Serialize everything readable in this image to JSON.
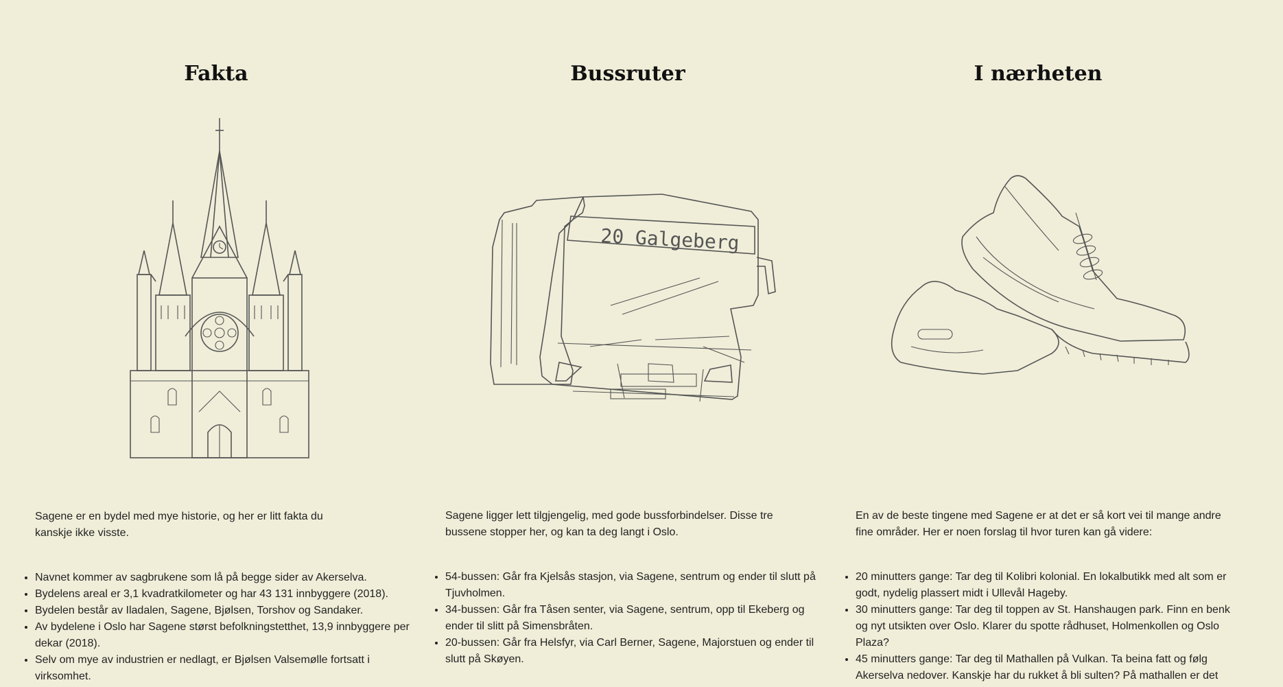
{
  "columns": [
    {
      "title": "Fakta",
      "icon": "church-illustration",
      "intro": "Sagene er en bydel med mye historie, og her er litt fakta du kanskje ikke visste.",
      "items": [
        "Navnet kommer av sagbrukene som lå på begge sider av Akerselva.",
        "Bydelens areal er 3,1 kvadratkilometer og har 43 131 innbyggere (2018).",
        "Bydelen består av Iladalen, Sagene, Bjølsen, Torshov og Sandaker.",
        "Av bydelene i Oslo har Sagene størst befolkningstetthet, 13,9 innbyggere per dekar (2018).",
        "Selv om mye av industrien er nedlagt, er Bjølsen Valsemølle fortsatt i virksomhet."
      ]
    },
    {
      "title": "Bussruter",
      "icon": "bus-illustration",
      "bus_sign": "20 Galgeberg",
      "intro": "Sagene ligger lett tilgjengelig, med gode bussforbindelser. Disse tre bussene stopper her, og kan ta deg langt i Oslo.",
      "items": [
        "54-bussen: Går fra Kjelsås stasjon, via Sagene, sentrum og ender til slutt på Tjuvholmen.",
        "34-bussen: Går fra Tåsen senter, via Sagene, sentrum, opp til Ekeberg og ender til slitt på Simensbråten.",
        "20-bussen: Går fra Helsfyr, via Carl Berner, Sagene, Majorstuen og ender til slutt på Skøyen."
      ]
    },
    {
      "title": "I nærheten",
      "icon": "sneaker-illustration",
      "intro": "En av de beste tingene med Sagene er at det er så kort vei til mange andre fine områder. Her er noen forslag til hvor turen kan gå videre:",
      "items": [
        "20 minutters gange: Tar deg til Kolibri kolonial. En lokalbutikk med alt som er godt, nydelig plassert midt i Ullevål Hageby.",
        "30 minutters gange: Tar deg til toppen av St. Hanshaugen park. Finn en benk og nyt utsikten over Oslo. Klarer du spotte rådhuset, Holmenkollen og Oslo Plaza?",
        "45 minutters gange: Tar deg til Mathallen på Vulkan. Ta beina fatt og følg Akerselva nedover. Kanskje har du rukket å bli sulten? På mathallen er det"
      ]
    }
  ],
  "colors": {
    "background": "#f0eed9",
    "text": "#222222",
    "line_art": "#555555"
  }
}
